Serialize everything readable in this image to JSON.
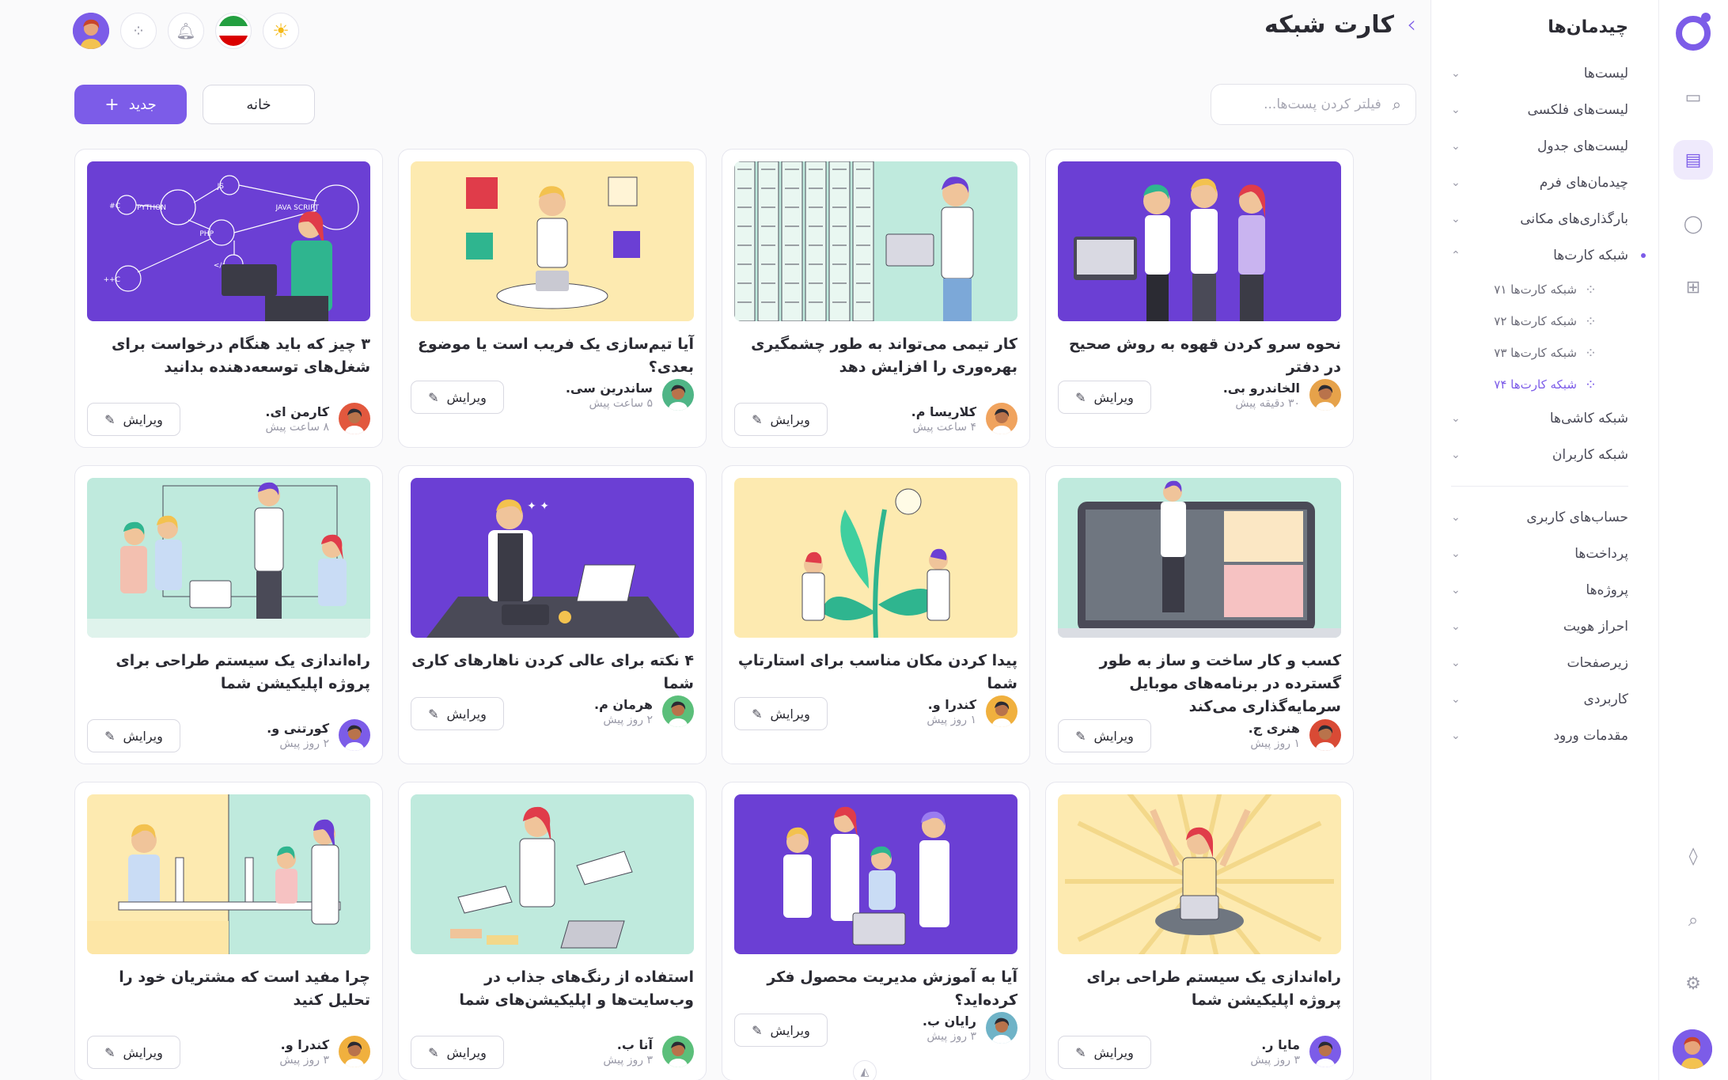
{
  "app": {
    "page_title": "کارت شبکه",
    "brand_color": "#7c5ce8"
  },
  "sidebar": {
    "title": "چیدمان‌ها",
    "items": [
      {
        "label": "لیست‌ها"
      },
      {
        "label": "لیست‌های فلکسی"
      },
      {
        "label": "لیست‌های جدول"
      },
      {
        "label": "چیدمان‌های فرم"
      },
      {
        "label": "بارگذاری‌های مکانی"
      },
      {
        "label": "شبکه کارت‌ها",
        "open": true
      },
      {
        "label": "شبکه کاشی‌ها"
      },
      {
        "label": "شبکه کاربران"
      }
    ],
    "subitems": [
      {
        "label": "شبکه کارت‌ها ۷۱"
      },
      {
        "label": "شبکه کارت‌ها ۷۲"
      },
      {
        "label": "شبکه کارت‌ها ۷۳"
      },
      {
        "label": "شبکه کارت‌ها ۷۴",
        "active": true
      }
    ],
    "items2": [
      {
        "label": "حساب‌های کاربری"
      },
      {
        "label": "پرداخت‌ها"
      },
      {
        "label": "پروژه‌ها"
      },
      {
        "label": "احراز هویت"
      },
      {
        "label": "زیرصفحات"
      },
      {
        "label": "کاربردی"
      },
      {
        "label": "مقدمات ورود"
      }
    ]
  },
  "toolbar": {
    "search_placeholder": "فیلتر کردن پست‌ها...",
    "home_label": "خانه",
    "new_label": "جدید"
  },
  "cards": [
    {
      "title": "نحوه سرو کردن قهوه به روش صحیح در دفتر",
      "author": "الخاندرو بی.",
      "time": "۳۰ دقیقه پیش",
      "edit": "ویرایش",
      "bg": "#6b3fd4",
      "layout": "short",
      "av": "#e6a24a"
    },
    {
      "title": "کار تیمی می‌تواند به طور چشمگیری بهره‌وری را افزایش دهد",
      "author": "کلاریسا م.",
      "time": "۴ ساعت پیش",
      "edit": "ویرایش",
      "bg": "#bfeadd",
      "layout": "long",
      "av": "#f0a35e"
    },
    {
      "title": "آیا تیم‌سازی یک فریب است یا موضوع بعدی؟",
      "author": "ساندرین سی.",
      "time": "۵ ساعت پیش",
      "edit": "ویرایش",
      "bg": "#fdeab0",
      "layout": "short",
      "av": "#4fb586"
    },
    {
      "title": "۳ چیز که باید هنگام درخواست برای شغل‌های توسعه‌دهنده بدانید",
      "author": "کارمن ای.",
      "time": "۸ ساعت پیش",
      "edit": "ویرایش",
      "bg": "#6b3fd4",
      "layout": "long",
      "av": "#e2583e"
    },
    {
      "title": "کسب و کار ساخت و ساز به طور گسترده در برنامه‌های موبایل سرمایه‌گذاری می‌کند",
      "author": "هنری ج.",
      "time": "۱ روز پیش",
      "edit": "ویرایش",
      "bg": "#bfeadd",
      "layout": "long",
      "av": "#d94a35"
    },
    {
      "title": "پیدا کردن مکان مناسب برای استارتاپ شما",
      "author": "کندرا و.",
      "time": "۱ روز پیش",
      "edit": "ویرایش",
      "bg": "#fdeab0",
      "layout": "short",
      "av": "#f0b03e"
    },
    {
      "title": "۴ نکته برای عالی کردن ناهارهای کاری شما",
      "author": "هرمان م.",
      "time": "۲ روز پیش",
      "edit": "ویرایش",
      "bg": "#6b3fd4",
      "layout": "short",
      "av": "#5bbf7a"
    },
    {
      "title": "راه‌اندازی یک سیستم طراحی برای پروژه اپلیکیشن شما",
      "author": "کورتنی و.",
      "time": "۲ روز پیش",
      "edit": "ویرایش",
      "bg": "#bfeadd",
      "layout": "long",
      "av": "#7c5ce8"
    },
    {
      "title": "راه‌اندازی یک سیستم طراحی برای پروژه اپلیکیشن شما",
      "author": "مایا ر.",
      "time": "۳ روز پیش",
      "edit": "ویرایش",
      "bg": "#fdeab0",
      "layout": "long",
      "av": "#7c5ce8"
    },
    {
      "title": "آیا به آموزش مدیریت محصول فکر کرده‌اید؟",
      "author": "رایان ب.",
      "time": "۳ روز پیش",
      "edit": "ویرایش",
      "bg": "#6b3fd4",
      "layout": "short",
      "av": "#6fb3c7"
    },
    {
      "title": "استفاده از رنگ‌های جذاب در وب‌سایت‌ها و اپلیکیشن‌های شما",
      "author": "آنا ب.",
      "time": "۳ روز پیش",
      "edit": "ویرایش",
      "bg": "#bfeadd",
      "layout": "long",
      "av": "#5bbf7a"
    },
    {
      "title": "چرا مفید است که مشتریان خود را تحلیل کنید",
      "author": "کندرا و.",
      "time": "۳ روز پیش",
      "edit": "ویرایش",
      "bg": "#fdeab0",
      "layout": "long",
      "av": "#f0b03e"
    }
  ]
}
